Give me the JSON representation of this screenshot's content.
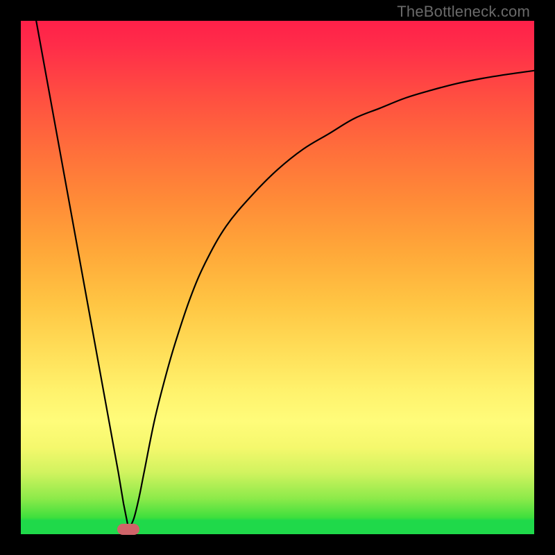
{
  "watermark": "TheBottleneck.com",
  "colors": {
    "frame": "#000000",
    "curve": "#000000",
    "marker": "#cf6469"
  },
  "chart_data": {
    "type": "line",
    "title": "",
    "xlabel": "",
    "ylabel": "",
    "xlim": [
      0,
      100
    ],
    "ylim": [
      0,
      100
    ],
    "grid": false,
    "legend": false,
    "marker": {
      "x": 21,
      "y": 1
    },
    "series": [
      {
        "name": "left-branch",
        "x": [
          3,
          5,
          7,
          9,
          11,
          13,
          15,
          17,
          19,
          20,
          21
        ],
        "y": [
          100,
          89,
          78,
          67,
          56,
          45,
          34,
          23,
          12,
          6,
          1
        ]
      },
      {
        "name": "right-branch",
        "x": [
          21,
          22,
          23,
          24,
          26,
          28,
          30,
          33,
          36,
          40,
          45,
          50,
          55,
          60,
          65,
          70,
          75,
          80,
          85,
          90,
          95,
          100
        ],
        "y": [
          1,
          3,
          7,
          12,
          22,
          30,
          37,
          46,
          53,
          60,
          66,
          71,
          75,
          78,
          81,
          83,
          85,
          86.5,
          87.8,
          88.8,
          89.6,
          90.3
        ]
      }
    ]
  }
}
